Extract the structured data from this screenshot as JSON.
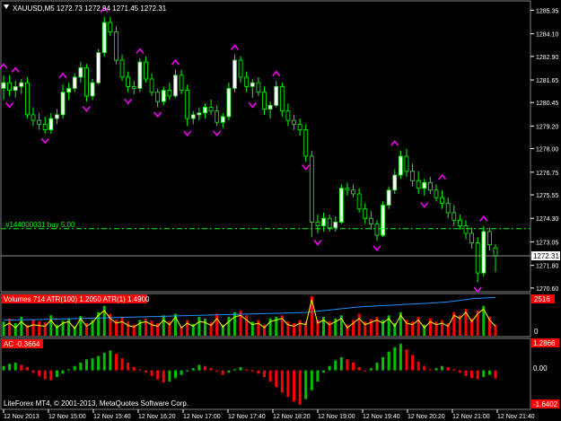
{
  "header": {
    "symbol_label": "XAUUSD,M5  1272.73 1272.94 1271.45 1272.31"
  },
  "order_line": {
    "label": "#144000031 buy 5.00",
    "price": 1273.75
  },
  "price_panel": {
    "current_price_label": "1272.31",
    "current_price": 1272.31,
    "y_tick_labels": [
      "1285.35",
      "1284.10",
      "1282.90",
      "1281.65",
      "1280.45",
      "1279.20",
      "1278.00",
      "1276.75",
      "1275.55",
      "1274.30",
      "1273.05",
      "1271.80",
      "1270.60"
    ],
    "y_tick_values": [
      1285.35,
      1284.1,
      1282.9,
      1281.65,
      1280.45,
      1279.2,
      1278.0,
      1276.75,
      1275.55,
      1274.3,
      1273.05,
      1271.8,
      1270.6
    ],
    "ylim": [
      1270.45,
      1285.8
    ]
  },
  "volume_panel": {
    "label": "Volumes 714  ATR(100) 1.2050  ATR(1) 1.4900",
    "max_label": "2516",
    "zero_label": "0"
  },
  "ac_panel": {
    "label": "AC -0.3664",
    "top_label": "1.2866",
    "zero_label": "0.00",
    "bottom_label": "-1.6402"
  },
  "copyright": "LiteForex MT4, © 2001-2013, MetaQuotes Software Corp.",
  "x_tick_labels": [
    "12 Nov 2013",
    "12 Nov 15:00",
    "12 Nov 15:40",
    "12 Nov 16:20",
    "12 Nov 17:00",
    "12 Nov 17:40",
    "12 Nov 18:20",
    "12 Nov 19:00",
    "12 Nov 19:40",
    "12 Nov 20:20",
    "12 Nov 21:00",
    "12 Nov 21:40"
  ],
  "colors": {
    "background": "#000000",
    "bull_candle": "#ffffff",
    "bear_candle": "#000000",
    "wick": "#00ff00",
    "fractal": "#ff00ff",
    "order_line": "#00ff00",
    "volume_up": "#00c000",
    "volume_down": "#ff0000",
    "atr100": "#1e90ff",
    "atr1": "#ffff00",
    "ac_up": "#00c000",
    "ac_down": "#ff0000",
    "axis_text": "#ffffff",
    "label_box": "#ff0000"
  },
  "chart_data": {
    "type": "candlestick",
    "symbol": "XAUUSD",
    "timeframe": "M5",
    "candles": [
      [
        1281.2,
        1281.9,
        1280.6,
        1281.5
      ],
      [
        1281.5,
        1281.9,
        1280.8,
        1281.1
      ],
      [
        1281.1,
        1281.6,
        1280.7,
        1281.3
      ],
      [
        1281.3,
        1281.7,
        1280.9,
        1281.5
      ],
      [
        1281.5,
        1281.8,
        1279.6,
        1279.8
      ],
      [
        1279.8,
        1280.2,
        1279.2,
        1279.5
      ],
      [
        1279.5,
        1279.9,
        1279.0,
        1279.3
      ],
      [
        1279.3,
        1279.7,
        1278.8,
        1279.0
      ],
      [
        1279.0,
        1279.9,
        1278.8,
        1279.6
      ],
      [
        1279.6,
        1280.1,
        1279.3,
        1279.8
      ],
      [
        1279.8,
        1281.4,
        1279.6,
        1281.0
      ],
      [
        1281.0,
        1281.5,
        1280.6,
        1281.2
      ],
      [
        1281.2,
        1282.0,
        1281.0,
        1281.8
      ],
      [
        1281.8,
        1282.6,
        1281.5,
        1282.3
      ],
      [
        1282.3,
        1282.5,
        1280.5,
        1280.8
      ],
      [
        1280.8,
        1281.7,
        1280.6,
        1281.5
      ],
      [
        1281.5,
        1283.3,
        1281.4,
        1283.1
      ],
      [
        1283.1,
        1285.0,
        1282.9,
        1284.7
      ],
      [
        1284.7,
        1285.0,
        1284.0,
        1284.2
      ],
      [
        1284.2,
        1284.5,
        1282.5,
        1282.7
      ],
      [
        1282.7,
        1283.0,
        1281.6,
        1281.8
      ],
      [
        1281.8,
        1282.1,
        1281.0,
        1281.3
      ],
      [
        1281.3,
        1281.6,
        1280.9,
        1281.2
      ],
      [
        1281.2,
        1282.8,
        1281.0,
        1282.6
      ],
      [
        1282.6,
        1282.9,
        1281.5,
        1281.7
      ],
      [
        1281.7,
        1282.0,
        1280.8,
        1281.0
      ],
      [
        1281.0,
        1281.2,
        1280.2,
        1280.5
      ],
      [
        1280.5,
        1281.3,
        1280.3,
        1281.1
      ],
      [
        1281.1,
        1281.5,
        1280.6,
        1280.8
      ],
      [
        1280.8,
        1282.2,
        1280.7,
        1281.9
      ],
      [
        1281.9,
        1282.2,
        1280.9,
        1281.1
      ],
      [
        1281.1,
        1281.4,
        1279.2,
        1279.6
      ],
      [
        1279.6,
        1280.0,
        1279.3,
        1279.8
      ],
      [
        1279.8,
        1280.2,
        1279.5,
        1279.9
      ],
      [
        1279.9,
        1280.4,
        1279.6,
        1280.2
      ],
      [
        1280.2,
        1280.6,
        1279.8,
        1280.0
      ],
      [
        1280.0,
        1280.3,
        1279.2,
        1279.4
      ],
      [
        1279.4,
        1279.9,
        1279.1,
        1279.7
      ],
      [
        1279.7,
        1281.5,
        1279.5,
        1281.2
      ],
      [
        1281.2,
        1283.0,
        1281.0,
        1282.7
      ],
      [
        1282.7,
        1282.9,
        1281.5,
        1281.8
      ],
      [
        1281.8,
        1282.1,
        1281.0,
        1281.3
      ],
      [
        1281.3,
        1281.7,
        1280.7,
        1281.5
      ],
      [
        1281.5,
        1281.8,
        1280.8,
        1281.0
      ],
      [
        1281.0,
        1281.3,
        1279.8,
        1280.1
      ],
      [
        1280.1,
        1280.5,
        1279.6,
        1280.3
      ],
      [
        1280.3,
        1281.6,
        1280.2,
        1281.3
      ],
      [
        1281.3,
        1281.5,
        1279.7,
        1280.0
      ],
      [
        1280.0,
        1280.4,
        1279.2,
        1279.5
      ],
      [
        1279.5,
        1279.8,
        1279.0,
        1279.3
      ],
      [
        1279.3,
        1279.6,
        1278.7,
        1279.0
      ],
      [
        1279.0,
        1279.3,
        1277.3,
        1277.6
      ],
      [
        1277.6,
        1277.9,
        1273.3,
        1274.1
      ],
      [
        1274.1,
        1274.5,
        1273.5,
        1273.9
      ],
      [
        1273.9,
        1274.6,
        1273.6,
        1274.3
      ],
      [
        1274.3,
        1274.5,
        1273.6,
        1273.8
      ],
      [
        1273.8,
        1274.4,
        1273.6,
        1274.1
      ],
      [
        1274.1,
        1276.1,
        1274.0,
        1275.9
      ],
      [
        1275.9,
        1276.2,
        1275.5,
        1275.8
      ],
      [
        1275.8,
        1276.1,
        1275.4,
        1275.6
      ],
      [
        1275.6,
        1275.9,
        1274.6,
        1274.8
      ],
      [
        1274.8,
        1275.1,
        1274.0,
        1274.3
      ],
      [
        1274.3,
        1274.7,
        1273.7,
        1274.0
      ],
      [
        1274.0,
        1274.2,
        1273.1,
        1273.4
      ],
      [
        1273.4,
        1275.2,
        1273.3,
        1275.0
      ],
      [
        1275.0,
        1276.0,
        1274.8,
        1275.8
      ],
      [
        1275.8,
        1276.9,
        1275.6,
        1276.6
      ],
      [
        1276.6,
        1277.9,
        1276.4,
        1277.6
      ],
      [
        1277.6,
        1278.0,
        1276.5,
        1276.8
      ],
      [
        1276.8,
        1277.2,
        1276.0,
        1276.3
      ],
      [
        1276.3,
        1276.8,
        1275.6,
        1275.9
      ],
      [
        1275.9,
        1276.4,
        1275.5,
        1276.2
      ],
      [
        1276.2,
        1276.5,
        1275.6,
        1275.8
      ],
      [
        1275.8,
        1276.1,
        1275.2,
        1275.4
      ],
      [
        1275.4,
        1275.8,
        1274.8,
        1275.1
      ],
      [
        1275.1,
        1275.4,
        1274.3,
        1274.6
      ],
      [
        1274.6,
        1275.0,
        1273.9,
        1274.2
      ],
      [
        1274.2,
        1274.5,
        1273.7,
        1273.9
      ],
      [
        1273.9,
        1274.2,
        1273.2,
        1273.5
      ],
      [
        1273.5,
        1273.8,
        1272.7,
        1273.0
      ],
      [
        1273.0,
        1273.3,
        1270.9,
        1271.4
      ],
      [
        1271.4,
        1273.9,
        1271.2,
        1273.6
      ],
      [
        1273.6,
        1273.8,
        1272.6,
        1272.9
      ],
      [
        1272.73,
        1272.94,
        1271.45,
        1272.31
      ]
    ],
    "fractals_up": [
      [
        0,
        1282.4
      ],
      [
        2,
        1282.2
      ],
      [
        10,
        1281.9
      ],
      [
        17,
        1285.4
      ],
      [
        23,
        1283.2
      ],
      [
        29,
        1282.6
      ],
      [
        39,
        1283.4
      ],
      [
        46,
        1282.0
      ],
      [
        66,
        1278.3
      ],
      [
        74,
        1276.5
      ],
      [
        81,
        1274.3
      ]
    ],
    "fractals_down": [
      [
        1,
        1280.3
      ],
      [
        7,
        1278.4
      ],
      [
        14,
        1280.1
      ],
      [
        21,
        1280.5
      ],
      [
        26,
        1279.8
      ],
      [
        31,
        1278.8
      ],
      [
        36,
        1278.8
      ],
      [
        42,
        1280.3
      ],
      [
        51,
        1277.0
      ],
      [
        53,
        1273.0
      ],
      [
        63,
        1272.7
      ],
      [
        71,
        1275.0
      ],
      [
        80,
        1270.5
      ]
    ],
    "volumes": [
      900,
      1100,
      800,
      1200,
      700,
      1000,
      900,
      850,
      1300,
      700,
      950,
      1100,
      600,
      1250,
      800,
      1000,
      1500,
      1900,
      1400,
      1000,
      1150,
      900,
      700,
      1000,
      1100,
      950,
      800,
      1300,
      900,
      1400,
      600,
      1000,
      750,
      1200,
      1100,
      850,
      1400,
      700,
      1200,
      1500,
      1600,
      1300,
      900,
      1000,
      700,
      1100,
      1200,
      1300,
      900,
      800,
      1000,
      900,
      2516,
      1000,
      1200,
      900,
      1100,
      1300,
      700,
      1000,
      1400,
      900,
      1050,
      1200,
      1000,
      1300,
      800,
      1500,
      1000,
      900,
      1200,
      700,
      1100,
      900,
      1000,
      800,
      1500,
      1300,
      1700,
      1100,
      1600,
      1900,
      1200,
      714
    ],
    "atr100": [
      1000,
      1005,
      1010,
      1015,
      1020,
      1025,
      1030,
      1040,
      1050,
      1060,
      1070,
      1080,
      1090,
      1100,
      1110,
      1120,
      1130,
      1140,
      1150,
      1160,
      1170,
      1180,
      1190,
      1200,
      1210,
      1220,
      1230,
      1240,
      1250,
      1260,
      1270,
      1280,
      1290,
      1300,
      1310,
      1320,
      1330,
      1340,
      1350,
      1360,
      1370,
      1380,
      1390,
      1400,
      1410,
      1420,
      1430,
      1440,
      1450,
      1460,
      1470,
      1480,
      1520,
      1560,
      1600,
      1640,
      1680,
      1720,
      1760,
      1800,
      1830,
      1860,
      1880,
      1900,
      1920,
      1940,
      1960,
      1980,
      2000,
      2020,
      2040,
      2060,
      2080,
      2100,
      2130,
      2160,
      2200,
      2250,
      2300,
      2350,
      2380,
      2400,
      2420,
      2440
    ],
    "atr1": [
      600,
      800,
      500,
      900,
      550,
      700,
      650,
      600,
      1000,
      500,
      800,
      900,
      450,
      1100,
      600,
      850,
      1300,
      1600,
      1100,
      800,
      900,
      650,
      550,
      800,
      900,
      700,
      600,
      1000,
      700,
      1200,
      500,
      800,
      600,
      900,
      850,
      650,
      1100,
      550,
      900,
      1200,
      1300,
      1000,
      700,
      800,
      500,
      900,
      1000,
      1100,
      700,
      600,
      800,
      700,
      2300,
      800,
      1000,
      700,
      900,
      1100,
      500,
      800,
      1100,
      700,
      850,
      1000,
      800,
      1100,
      600,
      1300,
      800,
      700,
      1000,
      500,
      900,
      700,
      800,
      600,
      1300,
      1100,
      1500,
      900,
      1400,
      1700,
      1000,
      600
    ],
    "ac": [
      0.2,
      0.3,
      0.35,
      0.25,
      0.15,
      -0.1,
      -0.25,
      -0.4,
      -0.45,
      -0.3,
      -0.15,
      0.05,
      0.2,
      0.35,
      0.5,
      0.55,
      0.65,
      0.8,
      0.9,
      0.75,
      0.55,
      0.35,
      0.15,
      0.05,
      -0.1,
      -0.25,
      -0.4,
      -0.55,
      -0.5,
      -0.35,
      -0.2,
      -0.05,
      0.1,
      0.25,
      0.2,
      0.1,
      -0.05,
      -0.2,
      -0.1,
      0.05,
      0.15,
      0.05,
      -0.05,
      -0.15,
      -0.3,
      -0.5,
      -0.75,
      -1.0,
      -1.2,
      -1.4,
      -1.55,
      -1.3,
      -0.9,
      -0.5,
      -0.1,
      0.2,
      0.45,
      0.6,
      0.5,
      0.35,
      0.15,
      -0.05,
      0.1,
      0.35,
      0.6,
      0.85,
      1.05,
      1.2,
      0.95,
      0.7,
      0.4,
      0.2,
      0.05,
      0.1,
      0.2,
      0.15,
      0.05,
      -0.1,
      -0.25,
      -0.35,
      -0.4,
      -0.3,
      -0.2,
      -0.37
    ],
    "title": "XAUUSD,M5"
  }
}
